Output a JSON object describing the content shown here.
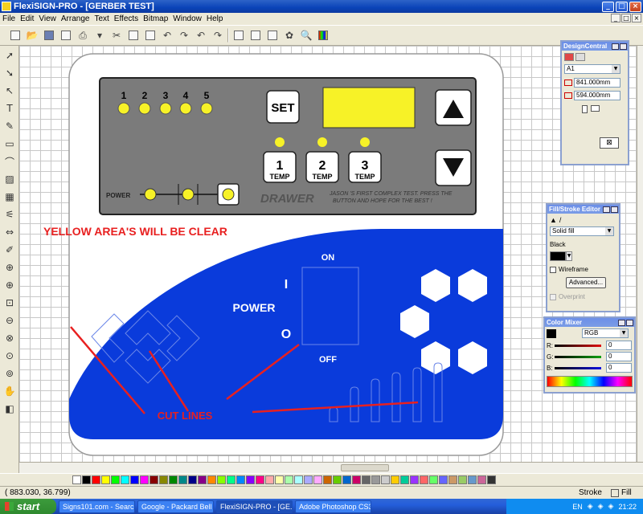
{
  "window": {
    "title": "FlexiSIGN-PRO - [GERBER TEST]"
  },
  "menu": [
    "File",
    "Edit",
    "View",
    "Arrange",
    "Text",
    "Effects",
    "Bitmap",
    "Window",
    "Help"
  ],
  "design": {
    "leds": [
      "1",
      "2",
      "3",
      "4",
      "5"
    ],
    "set_label": "SET",
    "temp_buttons": [
      {
        "number": "1",
        "label": "TEMP"
      },
      {
        "number": "2",
        "label": "TEMP"
      },
      {
        "number": "3",
        "label": "TEMP"
      }
    ],
    "power_label": "POWER",
    "drawer_label": "DRAWER",
    "note": "JASON 'S FIRST COMPLEX TEST. PRESS THE BUTTON AND HOPE FOR THE BEST !",
    "yellow_note": "YELLOW AREA'S WILL BE CLEAR",
    "on_label": "ON",
    "off_label": "OFF",
    "switch_i": "I",
    "switch_o": "O",
    "power_text": "POWER",
    "cut_lines": "CUT LINES",
    "colors": {
      "panel_gray": "#7b7b7b",
      "led_yellow": "#f7f227",
      "display_yellow": "#f7f227",
      "blue": "#0a3bdb",
      "red": "#e82020"
    }
  },
  "design_central": {
    "title": "DesignCentral",
    "font_value": "A1",
    "width_value": "841.000mm",
    "height_value": "594.000mm"
  },
  "fill_stroke": {
    "title": "Fill/Stroke Editor",
    "fill_type": "Solid fill",
    "color_name": "Black",
    "wireframe_label": "Wireframe",
    "advanced_label": "Advanced...",
    "overprint_label": "Overprint"
  },
  "color_mixer": {
    "title": "Color Mixer",
    "mode": "RGB",
    "channels": [
      {
        "label": "R:",
        "value": "0",
        "color": "#e01010"
      },
      {
        "label": "G:",
        "value": "0",
        "color": "#10a010"
      },
      {
        "label": "B:",
        "value": "0",
        "color": "#1010e0"
      }
    ]
  },
  "status": {
    "coords": "( 883.030,   36.799)",
    "stroke_label": "Stroke",
    "fill_label": "Fill"
  },
  "taskbar": {
    "start": "start",
    "tasks": [
      "Signs101.com - Searc...",
      "Google - Packard Bell",
      "FlexiSIGN-PRO - [GE...",
      "Adobe Photoshop CS3"
    ],
    "lang": "EN",
    "clock": "21:22"
  }
}
